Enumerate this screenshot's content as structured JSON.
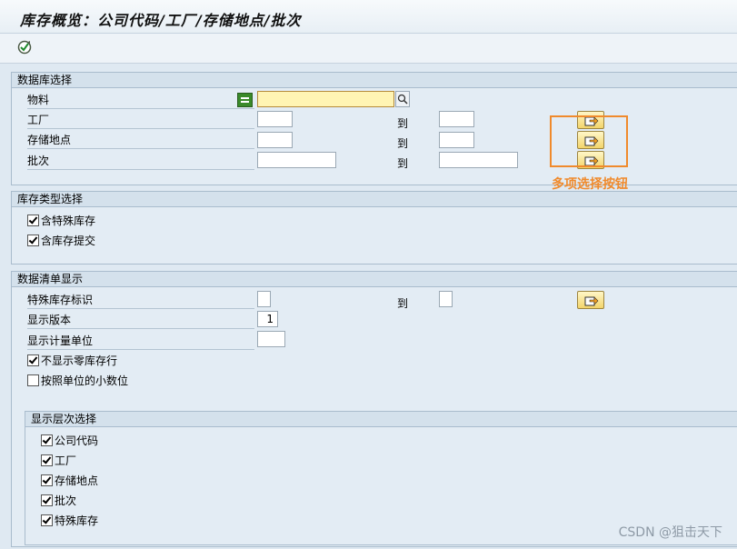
{
  "title": "库存概览：公司代码/工厂/存储地点/批次",
  "toolbar": {
    "execute_icon": "execute-icon"
  },
  "database_selection": {
    "header": "数据库选择",
    "to_label": "到",
    "rows": [
      {
        "label": "物料",
        "low": "",
        "high": null
      },
      {
        "label": "工厂",
        "low": "",
        "high": ""
      },
      {
        "label": "存储地点",
        "low": "",
        "high": ""
      },
      {
        "label": "批次",
        "low": "",
        "high": ""
      }
    ]
  },
  "stock_type_selection": {
    "header": "库存类型选择",
    "options": [
      {
        "label": "含特殊库存",
        "checked": true
      },
      {
        "label": "含库存提交",
        "checked": true
      }
    ]
  },
  "list_display": {
    "header": "数据清单显示",
    "special_stock_label": "特殊库存标识",
    "to_label": "到",
    "display_version_label": "显示版本",
    "display_version_value": "1",
    "display_unit_label": "显示计量单位",
    "options": [
      {
        "label": "不显示零库存行",
        "checked": true
      },
      {
        "label": "按照单位的小数位",
        "checked": false
      }
    ],
    "hierarchy": {
      "header": "显示层次选择",
      "options": [
        {
          "label": "公司代码",
          "checked": true
        },
        {
          "label": "工厂",
          "checked": true
        },
        {
          "label": "存储地点",
          "checked": true
        },
        {
          "label": "批次",
          "checked": true
        },
        {
          "label": "特殊库存",
          "checked": true
        }
      ]
    }
  },
  "annotation": "多项选择按钮",
  "watermark": "CSDN @狙击天下",
  "colors": {
    "annotation": "#f08a2c",
    "button": "#f3d46a",
    "active_field": "#fff4b3"
  }
}
